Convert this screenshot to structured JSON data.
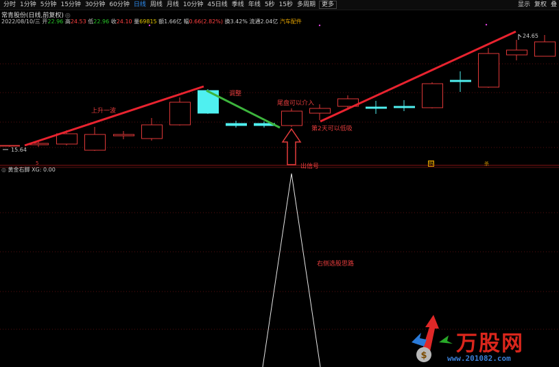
{
  "toolbar": {
    "periods": [
      "分时",
      "1分钟",
      "5分钟",
      "15分钟",
      "30分钟",
      "60分钟",
      "日线",
      "周线",
      "月线",
      "10分钟",
      "45日线",
      "季线",
      "年线",
      "5秒",
      "15秒",
      "多周期",
      "更多"
    ],
    "active_index": 6,
    "right_items": [
      "显示",
      "复权",
      "叠"
    ]
  },
  "header": {
    "title": "常青股份(日线,前复权)",
    "quote": {
      "date": "2022/08/10/三",
      "open_label": "开",
      "open": "22.96",
      "high_label": "高",
      "high": "24.53",
      "low_label": "低",
      "low": "22.96",
      "close_label": "收",
      "close": "24.10",
      "volume_label": "量",
      "volume": "69815",
      "amount_label": "额",
      "amount": "1.66亿",
      "change_label": "幅",
      "change": "0.66(2.82%)",
      "turnover_label": "换",
      "turnover": "3.42%",
      "float_label": "流通",
      "float": "2.04亿",
      "sector": "汽车配件"
    }
  },
  "annotations": {
    "rise_wave": "上升一波",
    "adjust": "调整",
    "tail_entry": "尾盘可以介入",
    "second_day": "第2天可以低吸",
    "signal": "出信号",
    "right_side_idea": "右侧选股思路",
    "low_price": "15.64",
    "high_price": "24.65",
    "marker_5": "5",
    "marker_buy": "购",
    "marker_sell": "杀"
  },
  "indicator": {
    "name": "黄金右脚",
    "label": "XG: 0.00"
  },
  "colors": {
    "up": "#e03838",
    "down": "#4ff0f0",
    "trend_line": "#e8232f",
    "adjust_line": "#3cb43c",
    "active_tab": "#2d8cf0"
  },
  "watermark": {
    "text": "万股网",
    "url": "www.201082.com"
  }
}
